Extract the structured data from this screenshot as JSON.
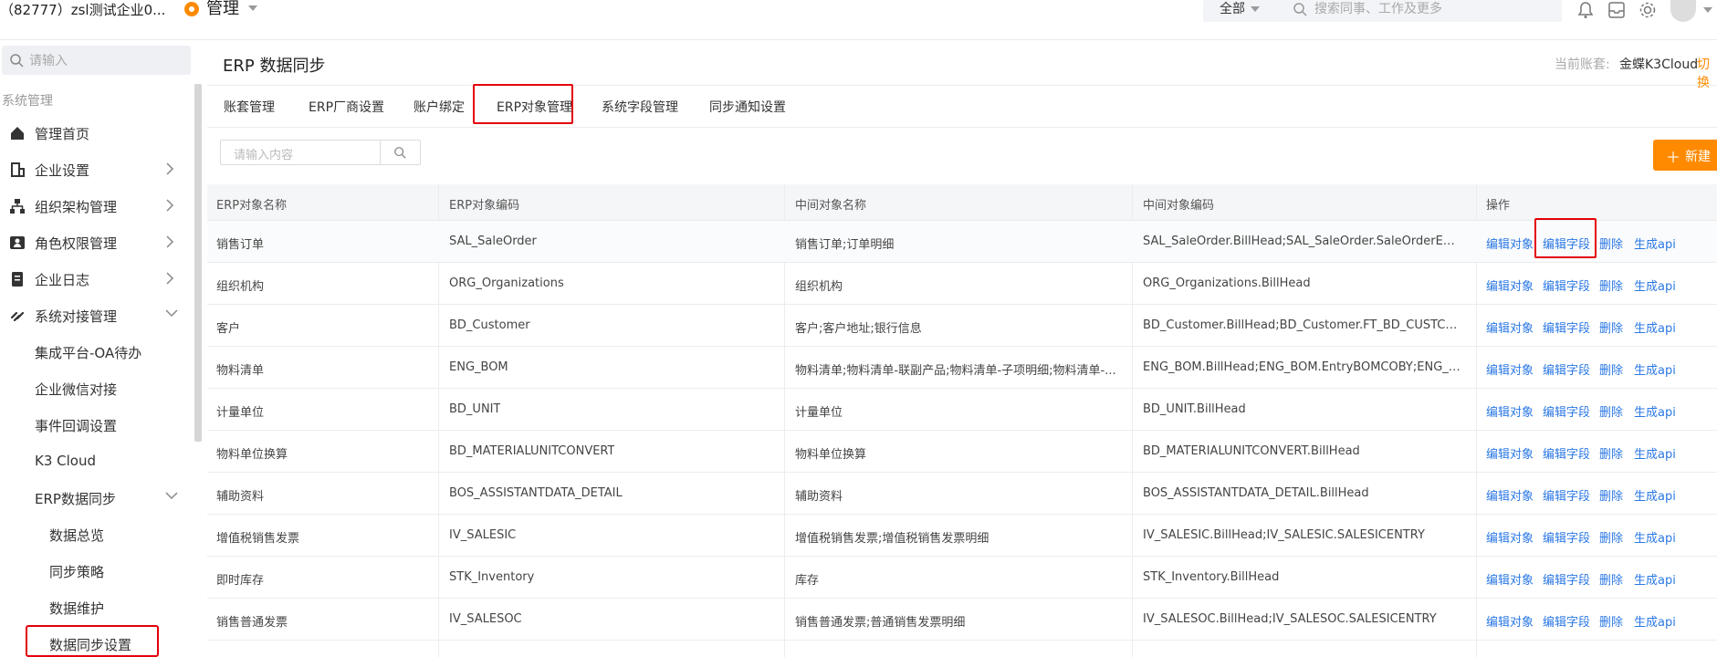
{
  "topbar": {
    "company": "（82777）zsl测试企业0...",
    "module_name": "管理",
    "scope": "全部",
    "search_placeholder": "搜索同事、工作及更多"
  },
  "sidebar": {
    "search_placeholder": "请输入",
    "group_label": "系统管理",
    "items": [
      {
        "label": "管理首页",
        "icon": "home-icon"
      },
      {
        "label": "企业设置",
        "icon": "building-icon"
      },
      {
        "label": "组织架构管理",
        "icon": "org-chart-icon"
      },
      {
        "label": "角色权限管理",
        "icon": "user-card-icon"
      },
      {
        "label": "企业日志",
        "icon": "document-icon"
      },
      {
        "label": "系统对接管理",
        "icon": "link-icon"
      },
      {
        "label": "集成平台-OA待办"
      },
      {
        "label": "企业微信对接"
      },
      {
        "label": "事件回调设置"
      },
      {
        "label": "K3 Cloud"
      },
      {
        "label": "ERP数据同步"
      },
      {
        "label": "数据总览"
      },
      {
        "label": "同步策略"
      },
      {
        "label": "数据维护"
      },
      {
        "label": "数据同步设置"
      }
    ]
  },
  "main": {
    "title": "ERP 数据同步",
    "account_label": "当前账套:",
    "account_value": "金蝶K3Cloud",
    "switch_label": "切换"
  },
  "tabs": [
    "账套管理",
    "ERP厂商设置",
    "账户绑定",
    "ERP对象管理",
    "系统字段管理",
    "同步通知设置"
  ],
  "toolbar": {
    "search_placeholder": "请输入内容",
    "new_button": "新建"
  },
  "table": {
    "headers": [
      "ERP对象名称",
      "ERP对象编码",
      "中间对象名称",
      "中间对象编码",
      "操作"
    ],
    "actions": [
      "编辑对象",
      "编辑字段",
      "删除",
      "生成api"
    ],
    "rows": [
      [
        "销售订单",
        "SAL_SaleOrder",
        "销售订单;订单明细",
        "SAL_SaleOrder.BillHead;SAL_SaleOrder.SaleOrderEntry"
      ],
      [
        "组织机构",
        "ORG_Organizations",
        "组织机构",
        "ORG_Organizations.BillHead"
      ],
      [
        "客户",
        "BD_Customer",
        "客户;客户地址;银行信息",
        "BD_Customer.BillHead;BD_Customer.FT_BD_CUSTCONTAC..."
      ],
      [
        "物料清单",
        "ENG_BOM",
        "物料清单;物料清单-联副产品;物料清单-子项明细;物料清单-...",
        "ENG_BOM.BillHead;ENG_BOM.EntryBOMCOBY;ENG_BOM.Tr..."
      ],
      [
        "计量单位",
        "BD_UNIT",
        "计量单位",
        "BD_UNIT.BillHead"
      ],
      [
        "物料单位换算",
        "BD_MATERIALUNITCONVERT",
        "物料单位换算",
        "BD_MATERIALUNITCONVERT.BillHead"
      ],
      [
        "辅助资料",
        "BOS_ASSISTANTDATA_DETAIL",
        "辅助资料",
        "BOS_ASSISTANTDATA_DETAIL.BillHead"
      ],
      [
        "增值税销售发票",
        "IV_SALESIC",
        "增值税销售发票;增值税销售发票明细",
        "IV_SALESIC.BillHead;IV_SALESIC.SALESICENTRY"
      ],
      [
        "即时库存",
        "STK_Inventory",
        "库存",
        "STK_Inventory.BillHead"
      ],
      [
        "销售普通发票",
        "IV_SALESOC",
        "销售普通发票;普通销售发票明细",
        "IV_SALESOC.BillHead;IV_SALESOC.SALESICENTRY"
      ]
    ]
  }
}
